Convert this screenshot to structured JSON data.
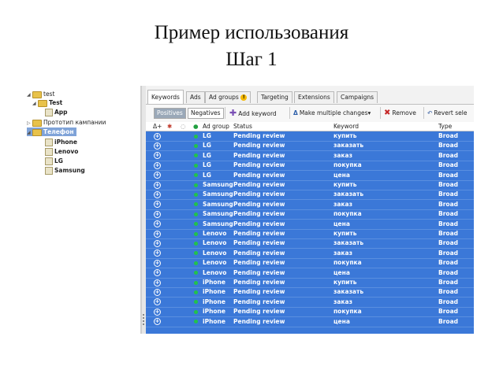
{
  "slide": {
    "title_line1": "Пример использования",
    "title_line2": "Шаг 1"
  },
  "tree": [
    {
      "label": "test",
      "bold": false,
      "icon": "folder",
      "arrow": "down"
    },
    {
      "label": "Test",
      "bold": true,
      "icon": "folder",
      "arrow": "down"
    },
    {
      "label": "App",
      "bold": true,
      "icon": "leaf",
      "arrow": ""
    },
    {
      "label": "Прототип кампании",
      "bold": false,
      "icon": "folder",
      "arrow": "right"
    },
    {
      "label": "Телефон",
      "bold": true,
      "icon": "folder",
      "arrow": "down",
      "selected": true
    },
    {
      "label": "iPhone",
      "bold": true,
      "icon": "leaf",
      "arrow": ""
    },
    {
      "label": "Lenovo",
      "bold": true,
      "icon": "leaf",
      "arrow": ""
    },
    {
      "label": "LG",
      "bold": true,
      "icon": "leaf",
      "arrow": ""
    },
    {
      "label": "Samsung",
      "bold": true,
      "icon": "leaf",
      "arrow": ""
    }
  ],
  "tabs": [
    "Keywords",
    "Ads",
    "Ad groups",
    "Targeting",
    "Extensions",
    "Campaigns"
  ],
  "tabs_badge": "!",
  "toolbar": {
    "positives": "Positives",
    "negatives": "Negatives",
    "add_keyword": "Add keyword",
    "multiple_changes": "Make multiple changes",
    "remove": "Remove",
    "revert": "Revert sele"
  },
  "columns": {
    "col_icons": [
      "Δ+",
      "✱",
      "◌",
      "●"
    ],
    "ad_group": "Ad group",
    "status": "Status",
    "keyword": "Keyword",
    "type": "Type"
  },
  "rows": [
    {
      "ad_group": "LG",
      "status": "Pending review",
      "keyword": "купить",
      "type": "Broad"
    },
    {
      "ad_group": "LG",
      "status": "Pending review",
      "keyword": "заказать",
      "type": "Broad"
    },
    {
      "ad_group": "LG",
      "status": "Pending review",
      "keyword": "заказ",
      "type": "Broad"
    },
    {
      "ad_group": "LG",
      "status": "Pending review",
      "keyword": "покупка",
      "type": "Broad"
    },
    {
      "ad_group": "LG",
      "status": "Pending review",
      "keyword": "цена",
      "type": "Broad"
    },
    {
      "ad_group": "Samsung",
      "status": "Pending review",
      "keyword": "купить",
      "type": "Broad"
    },
    {
      "ad_group": "Samsung",
      "status": "Pending review",
      "keyword": "заказать",
      "type": "Broad"
    },
    {
      "ad_group": "Samsung",
      "status": "Pending review",
      "keyword": "заказ",
      "type": "Broad"
    },
    {
      "ad_group": "Samsung",
      "status": "Pending review",
      "keyword": "покупка",
      "type": "Broad"
    },
    {
      "ad_group": "Samsung",
      "status": "Pending review",
      "keyword": "цена",
      "type": "Broad"
    },
    {
      "ad_group": "Lenovo",
      "status": "Pending review",
      "keyword": "купить",
      "type": "Broad"
    },
    {
      "ad_group": "Lenovo",
      "status": "Pending review",
      "keyword": "заказать",
      "type": "Broad"
    },
    {
      "ad_group": "Lenovo",
      "status": "Pending review",
      "keyword": "заказ",
      "type": "Broad"
    },
    {
      "ad_group": "Lenovo",
      "status": "Pending review",
      "keyword": "покупка",
      "type": "Broad"
    },
    {
      "ad_group": "Lenovo",
      "status": "Pending review",
      "keyword": "цена",
      "type": "Broad"
    },
    {
      "ad_group": "iPhone",
      "status": "Pending review",
      "keyword": "купить",
      "type": "Broad"
    },
    {
      "ad_group": "iPhone",
      "status": "Pending review",
      "keyword": "заказать",
      "type": "Broad"
    },
    {
      "ad_group": "iPhone",
      "status": "Pending review",
      "keyword": "заказ",
      "type": "Broad"
    },
    {
      "ad_group": "iPhone",
      "status": "Pending review",
      "keyword": "покупка",
      "type": "Broad"
    },
    {
      "ad_group": "iPhone",
      "status": "Pending review",
      "keyword": "цена",
      "type": "Broad"
    }
  ],
  "colors": {
    "selection": "#3b78d8",
    "status_dot": "#22c24a",
    "folder": "#e8c24a"
  }
}
